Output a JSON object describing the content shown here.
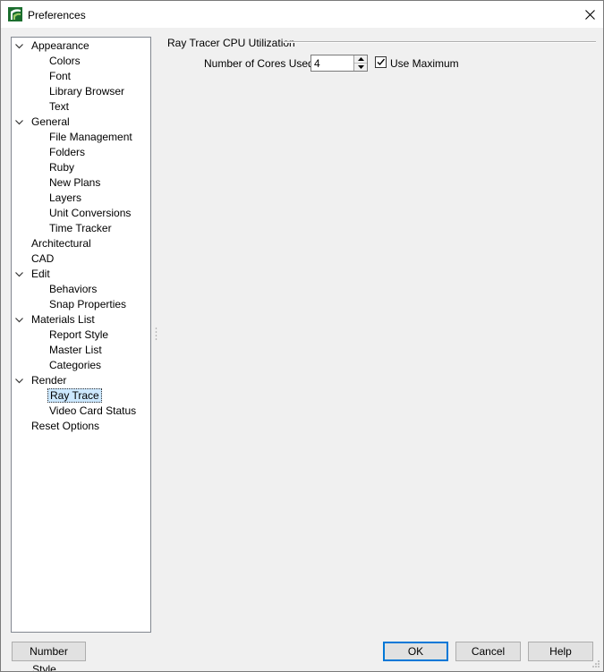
{
  "window": {
    "title": "Preferences",
    "icon": "chief-architect-app-icon"
  },
  "tree": {
    "items": [
      {
        "label": "Appearance",
        "level": 0,
        "expanded": true
      },
      {
        "label": "Colors",
        "level": 1
      },
      {
        "label": "Font",
        "level": 1
      },
      {
        "label": "Library Browser",
        "level": 1
      },
      {
        "label": "Text",
        "level": 1
      },
      {
        "label": "General",
        "level": 0,
        "expanded": true
      },
      {
        "label": "File Management",
        "level": 1
      },
      {
        "label": "Folders",
        "level": 1
      },
      {
        "label": "Ruby",
        "level": 1
      },
      {
        "label": "New Plans",
        "level": 1
      },
      {
        "label": "Layers",
        "level": 1
      },
      {
        "label": "Unit Conversions",
        "level": 1
      },
      {
        "label": "Time Tracker",
        "level": 1
      },
      {
        "label": "Architectural",
        "level": 0
      },
      {
        "label": "CAD",
        "level": 0
      },
      {
        "label": "Edit",
        "level": 0,
        "expanded": true
      },
      {
        "label": "Behaviors",
        "level": 1
      },
      {
        "label": "Snap Properties",
        "level": 1
      },
      {
        "label": "Materials List",
        "level": 0,
        "expanded": true
      },
      {
        "label": "Report Style",
        "level": 1
      },
      {
        "label": "Master List",
        "level": 1
      },
      {
        "label": "Categories",
        "level": 1
      },
      {
        "label": "Render",
        "level": 0,
        "expanded": true
      },
      {
        "label": "Ray Trace",
        "level": 1,
        "selected": true
      },
      {
        "label": "Video Card Status",
        "level": 1
      },
      {
        "label": "Reset Options",
        "level": 0
      }
    ]
  },
  "panel": {
    "group_title": "Ray Tracer CPU Utilization",
    "cores_label": "Number of Cores Used:",
    "cores_value": "4",
    "use_maximum_label": "Use Maximum",
    "use_maximum_checked": true
  },
  "buttons": {
    "number_style": "Number Style...",
    "ok": "OK",
    "cancel": "Cancel",
    "help": "Help"
  },
  "colors": {
    "selection": "#cce8ff",
    "default_button_border": "#0078d7",
    "brand_green": "#2e7d32"
  }
}
